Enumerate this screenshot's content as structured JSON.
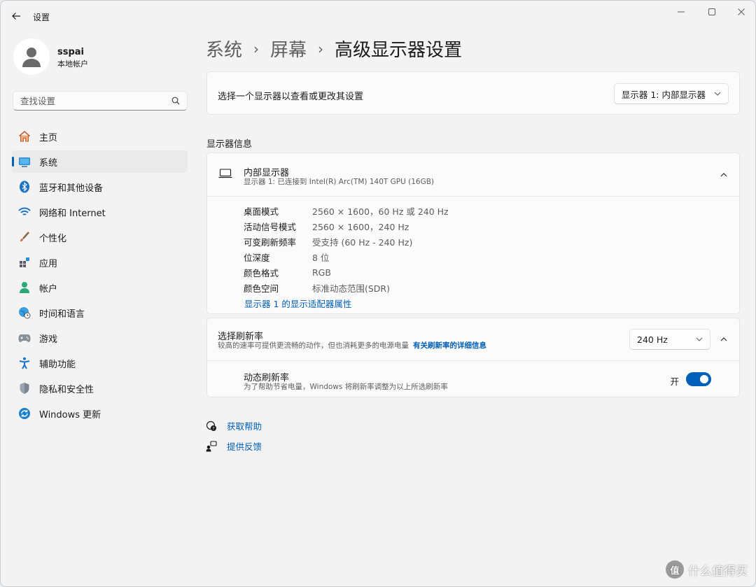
{
  "window": {
    "app_title": "设置",
    "controls": [
      "minimize-icon",
      "maximize-icon",
      "close-icon"
    ]
  },
  "user": {
    "name": "sspai",
    "account_type": "本地帐户"
  },
  "search": {
    "placeholder": "查找设置"
  },
  "sidebar": {
    "items": [
      {
        "label": "主页",
        "icon": "home-icon"
      },
      {
        "label": "系统",
        "icon": "system-icon",
        "active": true
      },
      {
        "label": "蓝牙和其他设备",
        "icon": "bluetooth-icon"
      },
      {
        "label": "网络和 Internet",
        "icon": "wifi-icon"
      },
      {
        "label": "个性化",
        "icon": "brush-icon"
      },
      {
        "label": "应用",
        "icon": "apps-icon"
      },
      {
        "label": "帐户",
        "icon": "account-icon"
      },
      {
        "label": "时间和语言",
        "icon": "globe-clock-icon"
      },
      {
        "label": "游戏",
        "icon": "gamepad-icon"
      },
      {
        "label": "辅助功能",
        "icon": "accessibility-icon"
      },
      {
        "label": "隐私和安全性",
        "icon": "shield-icon"
      },
      {
        "label": "Windows 更新",
        "icon": "update-icon"
      }
    ]
  },
  "breadcrumb": {
    "level1": "系统",
    "level2": "屏幕",
    "current": "高级显示器设置"
  },
  "select_display": {
    "label": "选择一个显示器以查看或更改其设置",
    "selected": "显示器 1: 内部显示器"
  },
  "display_info": {
    "section_title": "显示器信息",
    "name": "内部显示器",
    "subtitle": "显示器 1: 已连接到 Intel(R) Arc(TM) 140T GPU (16GB)",
    "rows": [
      {
        "key": "桌面模式",
        "value": "2560 × 1600，60 Hz 或 240 Hz"
      },
      {
        "key": "活动信号模式",
        "value": "2560 × 1600，240 Hz"
      },
      {
        "key": "可变刷新频率",
        "value": "受支持 (60 Hz - 240 Hz)"
      },
      {
        "key": "位深度",
        "value": "8 位"
      },
      {
        "key": "颜色格式",
        "value": "RGB"
      },
      {
        "key": "颜色空间",
        "value": "标准动态范围(SDR)"
      }
    ],
    "adapter_link": "显示器 1 的显示适配器属性"
  },
  "refresh_rate": {
    "title": "选择刷新率",
    "description": "较高的速率可提供更流畅的动作，但也消耗更多的电源电量",
    "more_link": "有关刷新率的详细信息",
    "selected": "240 Hz",
    "dynamic": {
      "title": "动态刷新率",
      "description": "为了帮助节省电量，Windows 将刷新率调整为以上所选刷新率",
      "state_label": "开",
      "on": true
    }
  },
  "footer": {
    "get_help": "获取帮助",
    "feedback": "提供反馈"
  },
  "watermark": {
    "badge": "值",
    "text": "什么值得买"
  },
  "colors": {
    "accent": "#005fb8",
    "background": "#f3f3f3",
    "card": "#fbfbfb"
  }
}
